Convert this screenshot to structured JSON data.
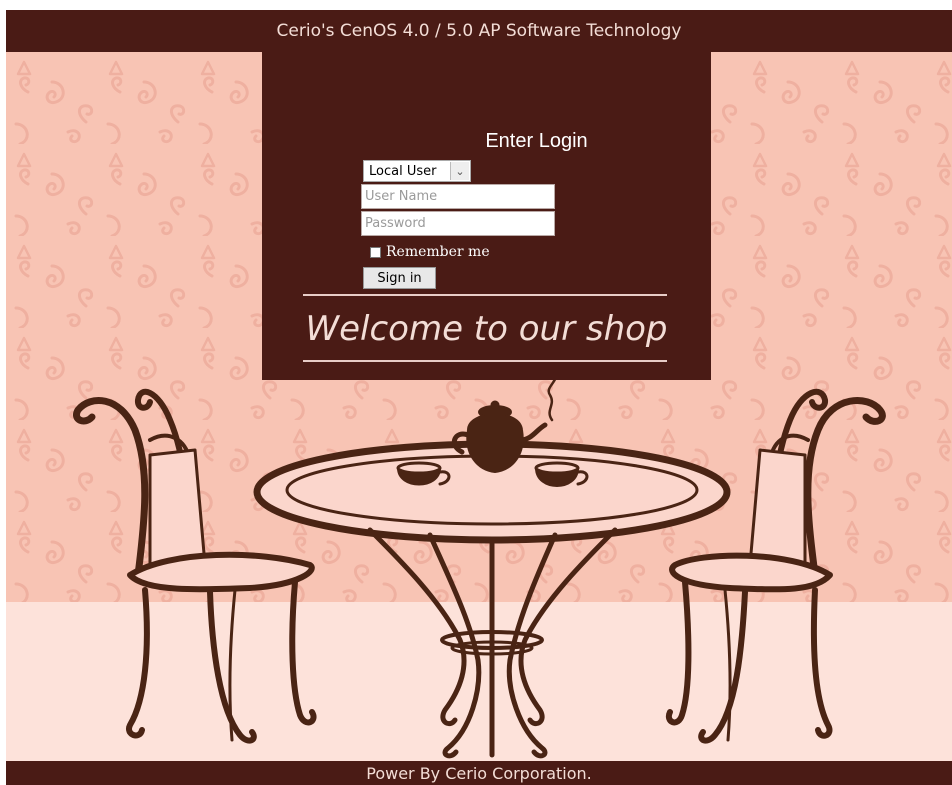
{
  "header": {
    "title": "Cerio's CenOS 4.0 / 5.0 AP Software Technology"
  },
  "login": {
    "title": "Enter Login",
    "user_type": {
      "selected": "Local User",
      "arrow_glyph": "⌄"
    },
    "username": {
      "value": "",
      "placeholder": "User Name"
    },
    "password": {
      "value": "",
      "placeholder": "Password"
    },
    "remember": {
      "label": "Remember me",
      "checked": false
    },
    "signin_label": "Sign in"
  },
  "welcome": "Welcome to our shop",
  "footer": {
    "text": "Power By Cerio Corporation."
  },
  "colors": {
    "panel": "#4a1b15",
    "wall": "#f8c4b4",
    "floor": "#fde2da",
    "pattern": "#efb0a0",
    "furniture": "#4a2414"
  },
  "icons": [
    "dropdown-arrow-icon",
    "checkbox-icon"
  ]
}
